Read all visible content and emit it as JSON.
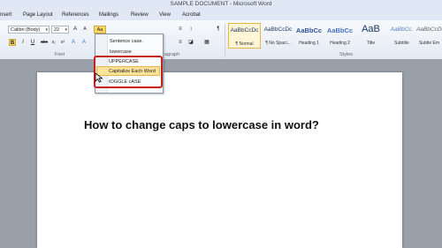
{
  "window": {
    "title": "SAMPLE DOCUMENT - Microsoft Word"
  },
  "ribbon_tabs": [
    "nsert",
    "Page Layout",
    "References",
    "Mailings",
    "Review",
    "View",
    "Acrobat"
  ],
  "font_group": {
    "font_name": "Calibri (Body)",
    "font_size": "22",
    "label": "Font",
    "bold": "B",
    "italic": "I",
    "underline": "U",
    "change_case": "Aa"
  },
  "paragraph_group": {
    "label": "agraph"
  },
  "styles_group": {
    "label": "Styles",
    "items": [
      {
        "sample": "AaBbCcDc",
        "name": "¶ Normal"
      },
      {
        "sample": "AaBbCcDc",
        "name": "¶ No Spaci..."
      },
      {
        "sample": "AaBbCc",
        "name": "Heading 1"
      },
      {
        "sample": "AaBbCc",
        "name": "Heading 2"
      },
      {
        "sample": "AaB",
        "name": "Title"
      },
      {
        "sample": "AaBbCc.",
        "name": "Subtitle"
      },
      {
        "sample": "AaBbCcDc",
        "name": "Subtle Em"
      }
    ]
  },
  "change_case_menu": {
    "items": [
      "Sentence case.",
      "lowercase",
      "UPPERCASE",
      "Capitalize Each Word",
      "tOGGLE cASE"
    ],
    "highlighted": "Capitalize Each Word"
  },
  "document": {
    "heading": "How to change caps to lowercase in word?"
  },
  "colors": {
    "highlight": "#fde29a",
    "red_outline": "#c8211d",
    "ribbon": "#dfe8f4"
  }
}
